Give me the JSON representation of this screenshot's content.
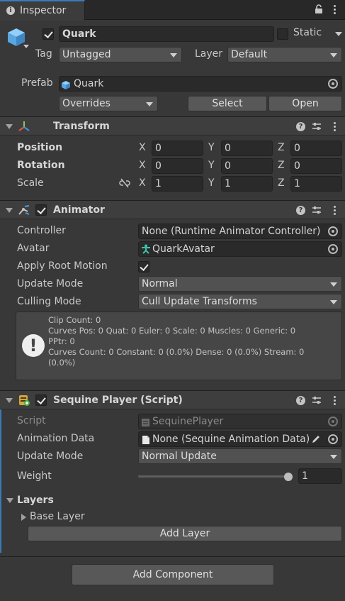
{
  "tab": {
    "title": "Inspector"
  },
  "gameobject": {
    "name": "Quark",
    "static_label": "Static",
    "tag_label": "Tag",
    "tag_value": "Untagged",
    "layer_label": "Layer",
    "layer_value": "Default",
    "prefab_label": "Prefab",
    "prefab_value": "Quark",
    "overrides_label": "Overrides",
    "select_label": "Select",
    "open_label": "Open"
  },
  "transform": {
    "title": "Transform",
    "rows": [
      {
        "label": "Position",
        "x": "0",
        "y": "0",
        "z": "0"
      },
      {
        "label": "Rotation",
        "x": "0",
        "y": "0",
        "z": "0"
      },
      {
        "label": "Scale",
        "x": "1",
        "y": "1",
        "z": "1"
      }
    ],
    "axes": {
      "x": "X",
      "y": "Y",
      "z": "Z"
    }
  },
  "animator": {
    "title": "Animator",
    "controller_label": "Controller",
    "controller_value": "None (Runtime Animator Controller)",
    "avatar_label": "Avatar",
    "avatar_value": "QuarkAvatar",
    "apply_root_label": "Apply Root Motion",
    "update_mode_label": "Update Mode",
    "update_mode_value": "Normal",
    "culling_label": "Culling Mode",
    "culling_value": "Cull Update Transforms",
    "info": [
      "Clip Count: 0",
      "Curves Pos: 0 Quat: 0 Euler: 0 Scale: 0 Muscles: 0 Generic: 0",
      "PPtr: 0",
      "Curves Count: 0 Constant: 0 (0.0%) Dense: 0 (0.0%) Stream: 0",
      "(0.0%)"
    ]
  },
  "sequine": {
    "title": "Sequine Player (Script)",
    "script_label": "Script",
    "script_value": "SequinePlayer",
    "anim_data_label": "Animation Data",
    "anim_data_value": "None (Sequine Animation Data)",
    "update_mode_label": "Update Mode",
    "update_mode_value": "Normal Update",
    "weight_label": "Weight",
    "weight_value": "1",
    "weight_fraction": 1.0,
    "layers_label": "Layers",
    "base_layer_label": "Base Layer",
    "add_layer_label": "Add Layer"
  },
  "footer": {
    "add_component_label": "Add Component"
  },
  "colors": {
    "accent": "#3a79bb",
    "background": "#383838",
    "field": "#2a2a2a",
    "header": "#3e3e3e"
  }
}
